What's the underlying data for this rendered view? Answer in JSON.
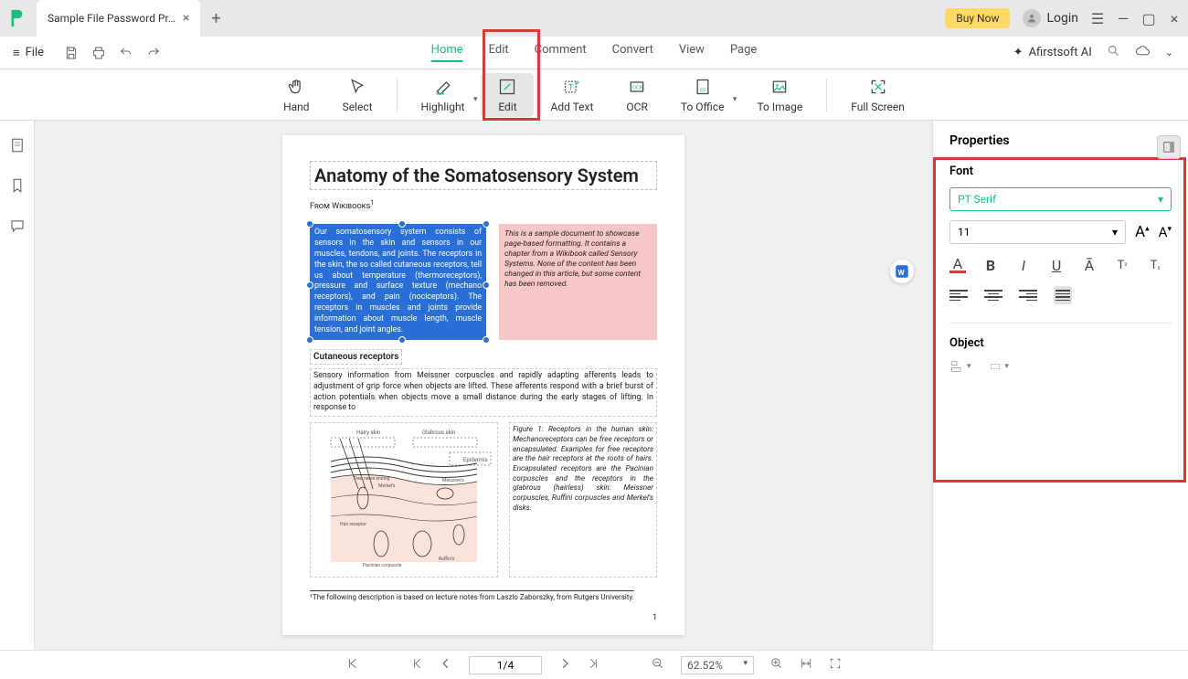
{
  "titlebar": {
    "tab_title": "Sample File Password Pr…",
    "buy_now": "Buy Now",
    "login": "Login"
  },
  "menubar": {
    "file": "File",
    "tabs": {
      "home": "Home",
      "edit": "Edit",
      "comment": "Comment",
      "convert": "Convert",
      "view": "View",
      "page": "Page"
    },
    "ai": "Afirstsoft AI"
  },
  "ribbon": {
    "hand": "Hand",
    "select": "Select",
    "highlight": "Highlight",
    "edit": "Edit",
    "add_text": "Add Text",
    "ocr": "OCR",
    "to_office": "To Office",
    "to_image": "To Image",
    "full_screen": "Full Screen"
  },
  "document": {
    "title": "Anatomy of the Somatosensory System",
    "from": "From Wikibooks",
    "selected_para": "Our somatosensory system consists of sensors in the skin and sensors in our muscles, tendons, and joints. The receptors in the skin, the so called cutaneous receptors, tell us about temperature (thermoreceptors), pressure and surface texture (mechano receptors), and pain (nociceptors). The receptors in muscles and joints provide information about muscle length, muscle tension, and joint angles.",
    "note": "This is a sample document to showcase page-based formatting. It contains a chapter from a Wikibook called Sensory Systems. None of the content has been changed in this article, but some content has been removed.",
    "section": "Cutaneous receptors",
    "body1": "Sensory information from Meissner corpuscles and rapidly adapting afferents leads to adjustment of grip force when objects are lifted. These afferents respond with a brief burst of action potentials when objects move a small distance during the early stages of lifting. In response to",
    "fig_caption": "Figure 1: Receptors in the human skin: Mechanoreceptors can be free receptors or encapsulated. Examples for free receptors are the hair receptors at the roots of hairs. Encapsulated receptors are the Pacinian corpuscles and the receptors in the glabrous (hairless) skin: Meissner corpuscles, Ruffini corpuscles and Merkel's disks.",
    "footnote": "¹The following description is based on lecture notes from Laszlo Zaborszky, from Rutgers University.",
    "page_num": "1"
  },
  "properties": {
    "title": "Properties",
    "font_section": "Font",
    "font_name": "PT Serif",
    "font_size": "11",
    "object_section": "Object"
  },
  "status": {
    "page": "1/4",
    "zoom": "62.52%"
  }
}
